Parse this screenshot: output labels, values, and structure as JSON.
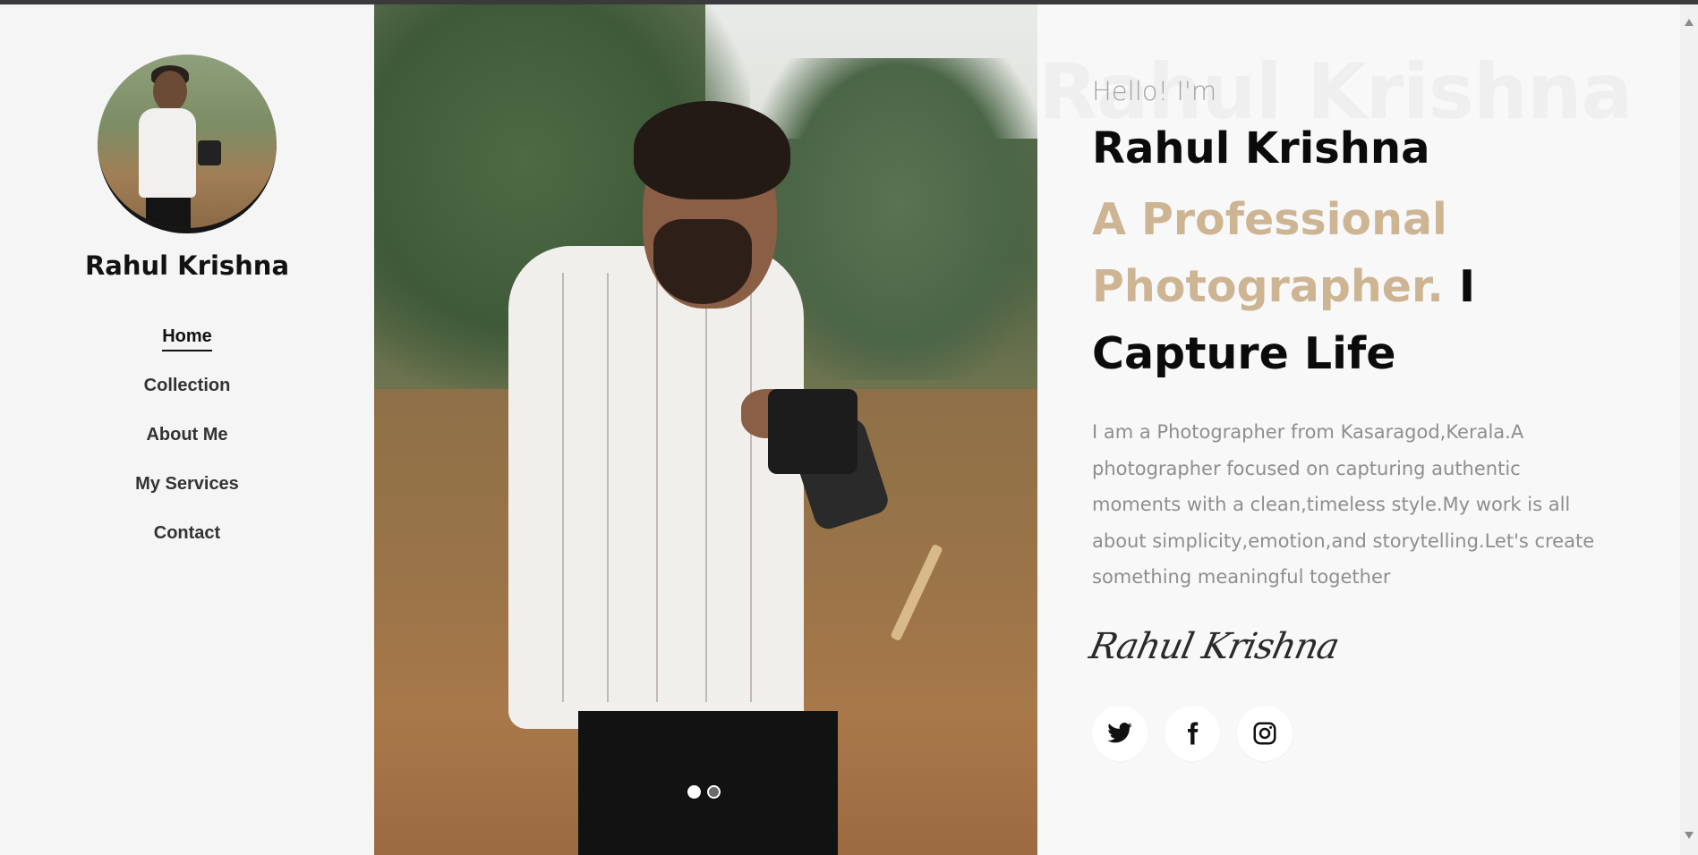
{
  "sidebar": {
    "profile_name": "Rahul Krishna",
    "nav": [
      {
        "label": "Home",
        "active": true
      },
      {
        "label": "Collection",
        "active": false
      },
      {
        "label": "About Me",
        "active": false
      },
      {
        "label": "My Services",
        "active": false
      },
      {
        "label": "Contact",
        "active": false
      }
    ]
  },
  "hero": {
    "watermark": "Rahul Krishna",
    "greeting": "Hello! I'm",
    "name": "Rahul Krishna",
    "tagline_accent": "A Professional Photographer.",
    "tagline_rest": " I Capture Life",
    "bio": "I am a Photographer from Kasaragod,Kerala.A photographer focused on capturing authentic moments with a clean,timeless style.My work is all about simplicity,emotion,and storytelling.Let's create something meaningful together",
    "signature": "Rahul Krishna",
    "social": [
      "twitter-icon",
      "facebook-icon",
      "instagram-icon"
    ]
  },
  "slider": {
    "slides": 2,
    "active_index": 0
  },
  "colors": {
    "accent": "#cdb594",
    "text": "#0b0b0b",
    "muted": "#8e8e8e",
    "background": "#f8f8f9"
  }
}
